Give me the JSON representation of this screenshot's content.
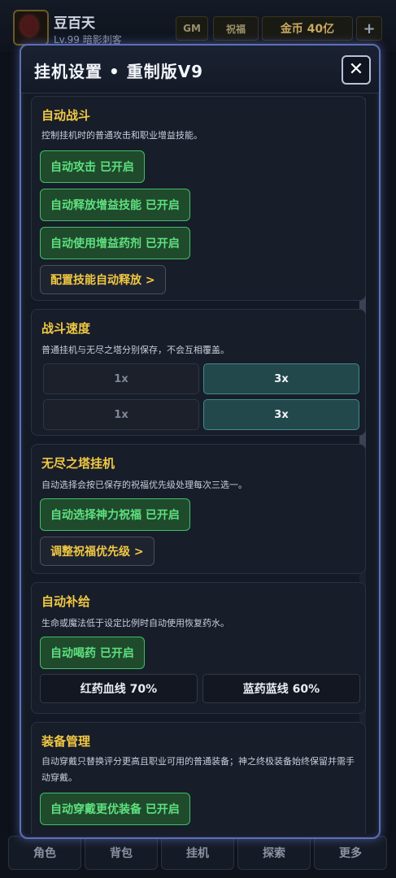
{
  "player": {
    "name": "豆百天",
    "level": "Lv.99  暗影刺客"
  },
  "top_bar": {
    "gm": "GM",
    "blessing": "祝福",
    "gold": "金币 40亿",
    "plus": "+"
  },
  "bottom_nav": [
    "角色",
    "背包",
    "挂机",
    "探索",
    "更多"
  ],
  "modal": {
    "title": "挂机设置  •  重制版V9",
    "close": "✕"
  },
  "sections": {
    "auto_battle": {
      "title": "自动战斗",
      "desc": "控制挂机时的普通攻击和职业增益技能。",
      "toggles": [
        "自动攻击   已开启",
        "自动释放增益技能   已开启",
        "自动使用增益药剂   已开启"
      ],
      "config": "配置技能自动释放   >"
    },
    "speed": {
      "title": "战斗速度",
      "desc": "普通挂机与无尽之塔分别保存，不会互相覆盖。",
      "rows": [
        {
          "off": "1x",
          "on": "3x"
        },
        {
          "off": "1x",
          "on": "3x"
        }
      ]
    },
    "tower": {
      "title": "无尽之塔挂机",
      "desc": "自动选择会按已保存的祝福优先级处理每次三选一。",
      "toggle": "自动选择神力祝福   已开启",
      "config": "调整祝福优先级   >"
    },
    "supply": {
      "title": "自动补给",
      "desc": "生命或魔法低于设定比例时自动使用恢复药水。",
      "toggle": "自动喝药   已开启",
      "hp": "红药血线 70%",
      "mp": "蓝药蓝线 60%"
    },
    "equip": {
      "title": "装备管理",
      "desc": "自动穿戴只替换评分更高且职业可用的普通装备；神之终极装备始终保留并需手动穿戴。",
      "toggle": "自动穿戴更优装备   已开启"
    }
  }
}
